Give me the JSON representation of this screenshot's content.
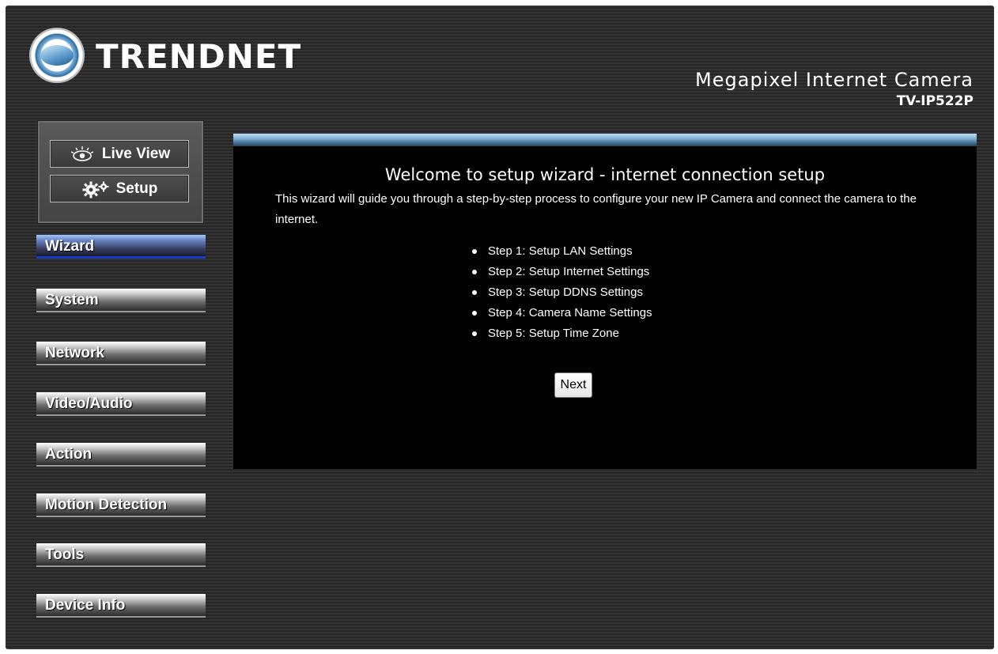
{
  "header": {
    "brand": "TRENDNET",
    "product_title": "Megapixel Internet Camera",
    "model": "TV-IP522P"
  },
  "mode_buttons": {
    "live_view": "Live View",
    "setup": "Setup"
  },
  "nav": {
    "items": [
      {
        "label": "Wizard",
        "active": true
      },
      {
        "label": "System"
      },
      {
        "label": "Network"
      },
      {
        "label": "Video/Audio"
      },
      {
        "label": "Action"
      },
      {
        "label": "Motion Detection"
      },
      {
        "label": "Tools"
      },
      {
        "label": "Device Info"
      }
    ]
  },
  "wizard": {
    "title": "Welcome to setup wizard - internet connection setup",
    "description": "This wizard will guide you through a step-by-step process to configure your new IP Camera and connect the camera to the internet.",
    "steps": [
      "Step 1: Setup LAN Settings",
      "Step 2: Setup Internet Settings",
      "Step 3: Setup DDNS Settings",
      "Step 4: Camera Name Settings",
      "Step 5: Setup Time Zone"
    ],
    "next_label": "Next"
  },
  "colors": {
    "active_nav_underline": "#1a39c8",
    "content_bar": "#7eaed2",
    "background": "#2e2e2e"
  },
  "icons": {
    "live_view": "eye-icon",
    "setup": "gears-icon",
    "logo": "globe-logo-icon"
  }
}
